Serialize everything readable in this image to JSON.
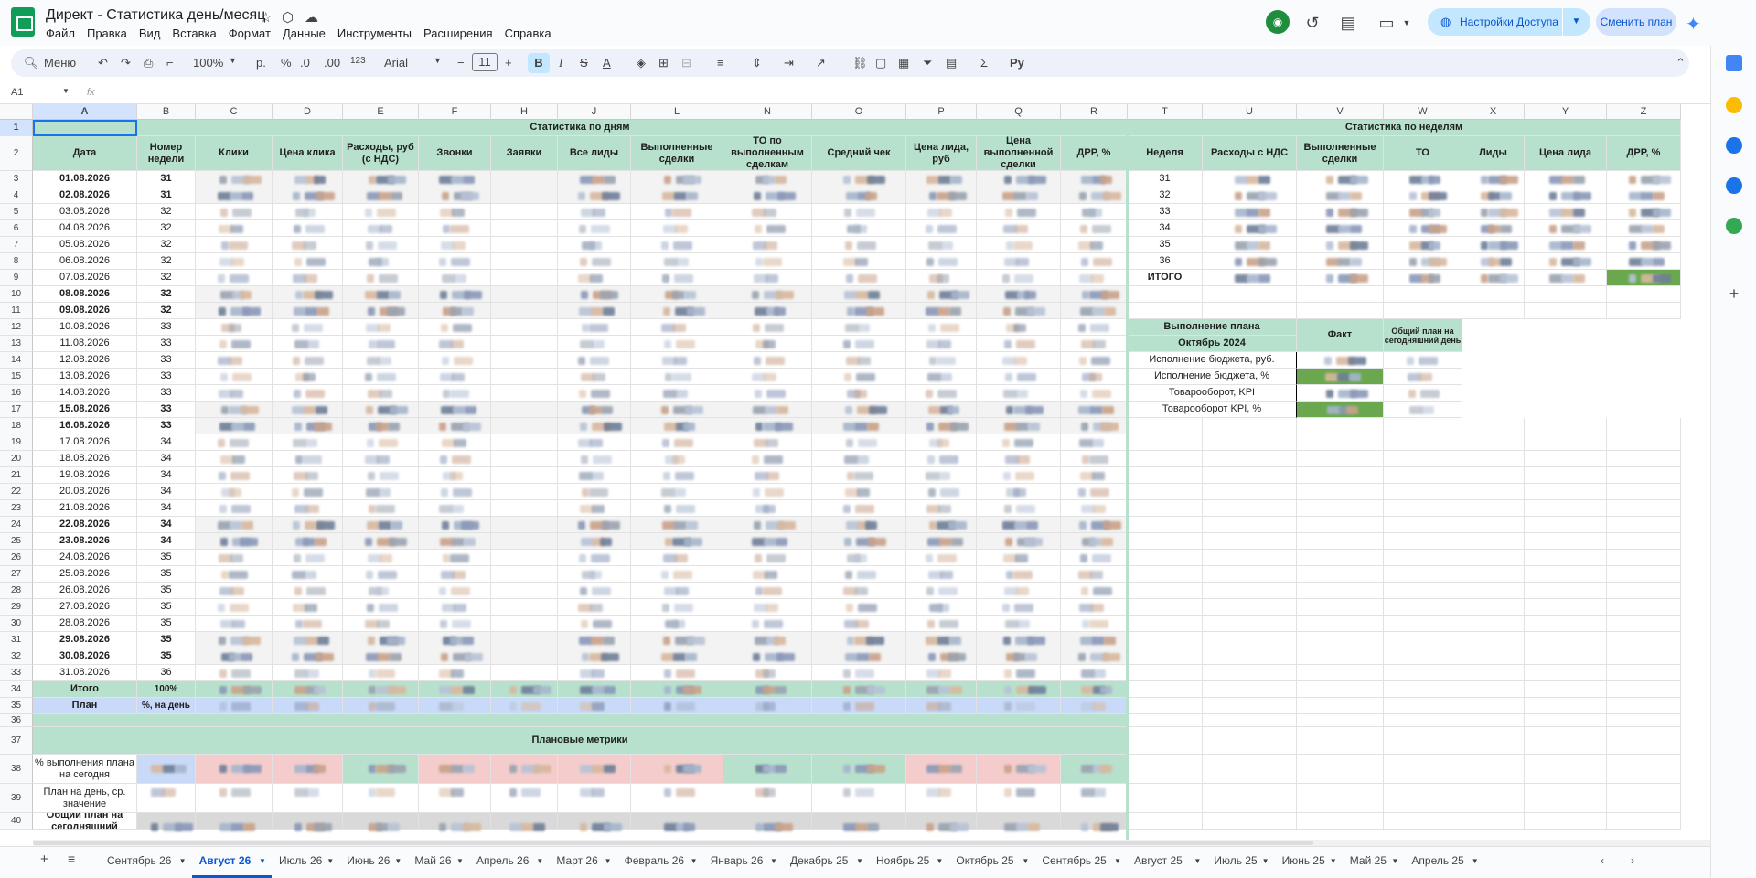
{
  "app": {
    "title": "Директ - Статистика день/месяц",
    "menu": [
      "Файл",
      "Правка",
      "Вид",
      "Вставка",
      "Формат",
      "Данные",
      "Инструменты",
      "Расширения",
      "Справка"
    ],
    "share_label": "Настройки Доступа",
    "plan_label": "Сменить план"
  },
  "toolbar": {
    "search": "Меню",
    "zoom": "100%",
    "currency": "р.",
    "percent": "%",
    "dec_minus": ".0",
    "dec_plus": ".00",
    "num": "123",
    "font": "Arial",
    "size": "11",
    "bold": "B",
    "italic": "I",
    "strike": "S",
    "textcolor": "A"
  },
  "formula": {
    "cell_ref": "A1",
    "fx": "fx",
    "value": ""
  },
  "columns": [
    "A",
    "B",
    "C",
    "D",
    "E",
    "F",
    "",
    "H",
    "J",
    "",
    "L",
    "",
    "N",
    "O",
    "P",
    "Q",
    "R",
    "",
    "T",
    "U",
    "V",
    "W",
    "X",
    "Y",
    "Z"
  ],
  "daily": {
    "section_title": "Статистика по дням",
    "headers": [
      "Дата",
      "Номер недели",
      "Клики",
      "Цена клика",
      "Расходы, руб (с НДС)",
      "Звонки",
      "Заявки",
      "Все лиды",
      "Выполненные сделки",
      "ТО по выполненным сделкам",
      "Средний чек",
      "Цена лида, руб",
      "Цена выполненной сделки",
      "ДРР, %"
    ],
    "rows": [
      {
        "date": "01.08.2026",
        "week": "31",
        "bold": true
      },
      {
        "date": "02.08.2026",
        "week": "31",
        "bold": true
      },
      {
        "date": "03.08.2026",
        "week": "32",
        "bold": false
      },
      {
        "date": "04.08.2026",
        "week": "32",
        "bold": false
      },
      {
        "date": "05.08.2026",
        "week": "32",
        "bold": false
      },
      {
        "date": "06.08.2026",
        "week": "32",
        "bold": false
      },
      {
        "date": "07.08.2026",
        "week": "32",
        "bold": false
      },
      {
        "date": "08.08.2026",
        "week": "32",
        "bold": true
      },
      {
        "date": "09.08.2026",
        "week": "32",
        "bold": true
      },
      {
        "date": "10.08.2026",
        "week": "33",
        "bold": false
      },
      {
        "date": "11.08.2026",
        "week": "33",
        "bold": false
      },
      {
        "date": "12.08.2026",
        "week": "33",
        "bold": false
      },
      {
        "date": "13.08.2026",
        "week": "33",
        "bold": false
      },
      {
        "date": "14.08.2026",
        "week": "33",
        "bold": false
      },
      {
        "date": "15.08.2026",
        "week": "33",
        "bold": true
      },
      {
        "date": "16.08.2026",
        "week": "33",
        "bold": true
      },
      {
        "date": "17.08.2026",
        "week": "34",
        "bold": false
      },
      {
        "date": "18.08.2026",
        "week": "34",
        "bold": false
      },
      {
        "date": "19.08.2026",
        "week": "34",
        "bold": false
      },
      {
        "date": "20.08.2026",
        "week": "34",
        "bold": false
      },
      {
        "date": "21.08.2026",
        "week": "34",
        "bold": false
      },
      {
        "date": "22.08.2026",
        "week": "34",
        "bold": true
      },
      {
        "date": "23.08.2026",
        "week": "34",
        "bold": true
      },
      {
        "date": "24.08.2026",
        "week": "35",
        "bold": false
      },
      {
        "date": "25.08.2026",
        "week": "35",
        "bold": false
      },
      {
        "date": "26.08.2026",
        "week": "35",
        "bold": false
      },
      {
        "date": "27.08.2026",
        "week": "35",
        "bold": false
      },
      {
        "date": "28.08.2026",
        "week": "35",
        "bold": false
      },
      {
        "date": "29.08.2026",
        "week": "35",
        "bold": true
      },
      {
        "date": "30.08.2026",
        "week": "35",
        "bold": true
      },
      {
        "date": "31.08.2026",
        "week": "36",
        "bold": false
      }
    ],
    "total_label": "Итого",
    "total_pct": "100%",
    "plan_label": "План",
    "plan_sub": "%, на день",
    "plan_metrics_title": "Плановые метрики",
    "metric_rows": [
      "% выполнения плана на сегодня",
      "План на день, ср. значение",
      "Общий план на сегодняшний"
    ]
  },
  "weekly": {
    "section_title": "Статистика по неделям",
    "headers": [
      "Неделя",
      "Расходы с НДС",
      "Выполненные сделки",
      "ТО",
      "Лиды",
      "Цена лида",
      "ДРР, %"
    ],
    "weeks": [
      "31",
      "32",
      "33",
      "34",
      "35",
      "36"
    ],
    "total_label": "ИТОГО"
  },
  "plan": {
    "title": "Выполнение плана",
    "month": "Октябрь 2024",
    "fact": "Факт",
    "today_plan": "Общий план на сегодняшний день",
    "rows": [
      "Исполнение бюджета, руб.",
      "Исполнение бюджета, %",
      "Товарооборот, KPI",
      "Товарооборот KPI, %"
    ]
  },
  "sheets": [
    "Сентябрь 26",
    "Август 26",
    "Июль 26",
    "Июнь 26",
    "Май 26",
    "Апрель 26",
    "Март 26",
    "Февраль 26",
    "Январь 26",
    "Декабрь 25",
    "Ноябрь 25",
    "Октябрь 25",
    "Сентябрь 25",
    "Август 25",
    "Июль 25",
    "Июнь 25",
    "Май 25",
    "Апрель 25"
  ],
  "active_sheet": "Август 26",
  "colors": {
    "header_green": "#b7e1cd",
    "plan_blue": "#c9daf8",
    "plan_red": "#f4cccc",
    "accent": "#0b57d0"
  }
}
